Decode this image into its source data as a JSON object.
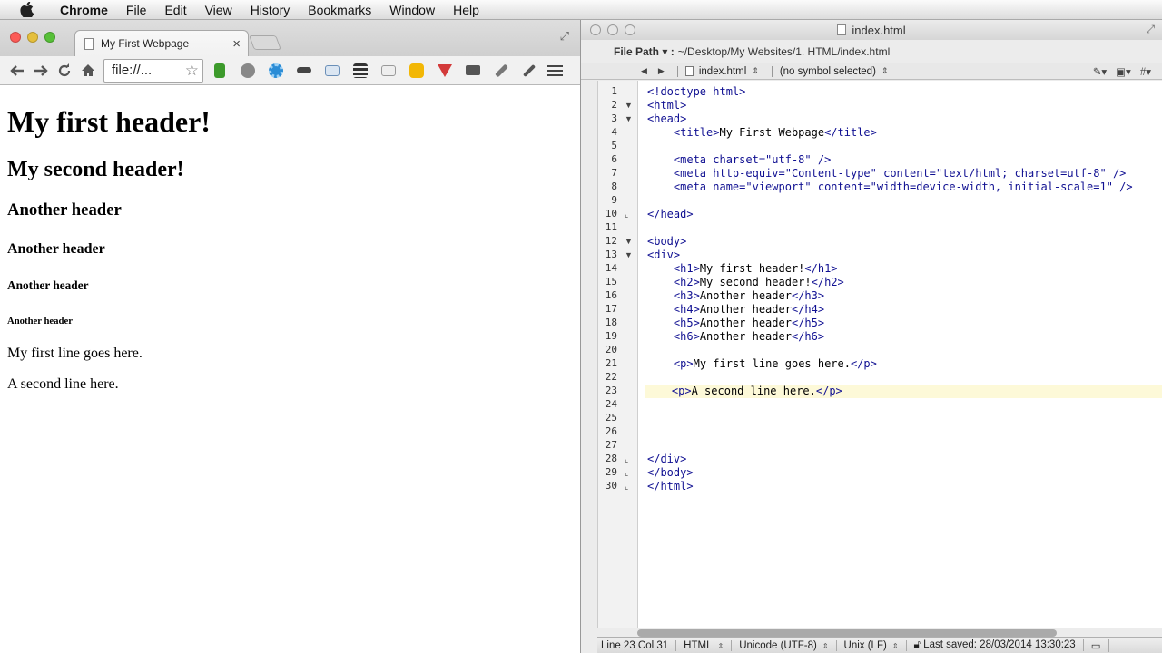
{
  "menubar": {
    "app": "Chrome",
    "items": [
      "File",
      "Edit",
      "View",
      "History",
      "Bookmarks",
      "Window",
      "Help"
    ]
  },
  "browser": {
    "tab_title": "My First Webpage",
    "tab_close": "×",
    "url": "file://...",
    "page": {
      "h1": "My first header!",
      "h2": "My second header!",
      "h3": "Another header",
      "h4": "Another header",
      "h5": "Another header",
      "h6": "Another header",
      "p1": "My first line goes here.",
      "p2": "A second line here."
    },
    "extensions": [
      {
        "icon": "evernote-icon",
        "color": "#3c9a2b"
      },
      {
        "icon": "download-icon",
        "color": "#777777"
      },
      {
        "icon": "blue-gear-icon",
        "color": "#2a8cd6"
      },
      {
        "icon": "mask-icon",
        "color": "#444444"
      },
      {
        "icon": "screenshot-icon",
        "color": "#6a8fb8"
      },
      {
        "icon": "buffer-icon",
        "color": "#333333"
      },
      {
        "icon": "gplus-icon",
        "color": "#999999"
      },
      {
        "icon": "badge-icon",
        "color": "#f2b705"
      },
      {
        "icon": "pocket-icon",
        "color": "#d33a3a"
      },
      {
        "icon": "camera-icon",
        "color": "#555555"
      },
      {
        "icon": "wrench-icon",
        "color": "#666666"
      },
      {
        "icon": "dropper-icon",
        "color": "#555555"
      }
    ]
  },
  "editor": {
    "window_title": "index.html",
    "path_label": "File Path ▾ :",
    "path_value": "~/Desktop/My Websites/1. HTML/index.html",
    "nav_file": "index.html",
    "nav_symbol": "(no symbol selected)",
    "lines": [
      {
        "n": "1",
        "code": "<!doctype html>"
      },
      {
        "n": "2",
        "code": "<html>"
      },
      {
        "n": "3",
        "code": "<head>"
      },
      {
        "n": "4",
        "code": "    <title>My First Webpage</title>"
      },
      {
        "n": "5",
        "code": ""
      },
      {
        "n": "6",
        "code": "    <meta charset=\"utf-8\" />"
      },
      {
        "n": "7",
        "code": "    <meta http-equiv=\"Content-type\" content=\"text/html; charset=utf-8\" />"
      },
      {
        "n": "8",
        "code": "    <meta name=\"viewport\" content=\"width=device-width, initial-scale=1\" />"
      },
      {
        "n": "9",
        "code": ""
      },
      {
        "n": "10",
        "code": "</head>"
      },
      {
        "n": "11",
        "code": ""
      },
      {
        "n": "12",
        "code": "<body>"
      },
      {
        "n": "13",
        "code": "<div>"
      },
      {
        "n": "14",
        "code": "    <h1>My first header!</h1>"
      },
      {
        "n": "15",
        "code": "    <h2>My second header!</h2>"
      },
      {
        "n": "16",
        "code": "    <h3>Another header</h3>"
      },
      {
        "n": "17",
        "code": "    <h4>Another header</h4>"
      },
      {
        "n": "18",
        "code": "    <h5>Another header</h5>"
      },
      {
        "n": "19",
        "code": "    <h6>Another header</h6>"
      },
      {
        "n": "20",
        "code": ""
      },
      {
        "n": "21",
        "code": "    <p>My first line goes here.</p>"
      },
      {
        "n": "22",
        "code": ""
      },
      {
        "n": "23",
        "code": "    <p>A second line here.</p>"
      },
      {
        "n": "24",
        "code": ""
      },
      {
        "n": "25",
        "code": ""
      },
      {
        "n": "26",
        "code": ""
      },
      {
        "n": "27",
        "code": ""
      },
      {
        "n": "28",
        "code": "</div>"
      },
      {
        "n": "29",
        "code": "</body>"
      },
      {
        "n": "30",
        "code": "</html>"
      }
    ],
    "current_line": "23",
    "fold_open_lines": [
      "2",
      "3",
      "12",
      "13"
    ],
    "fold_close_lines": [
      "10",
      "28",
      "29",
      "30"
    ],
    "status": {
      "position": "Line 23 Col 31",
      "language": "HTML",
      "encoding": "Unicode (UTF-8)",
      "line_endings": "Unix (LF)",
      "last_saved": "Last saved: 28/03/2014 13:30:23"
    }
  }
}
